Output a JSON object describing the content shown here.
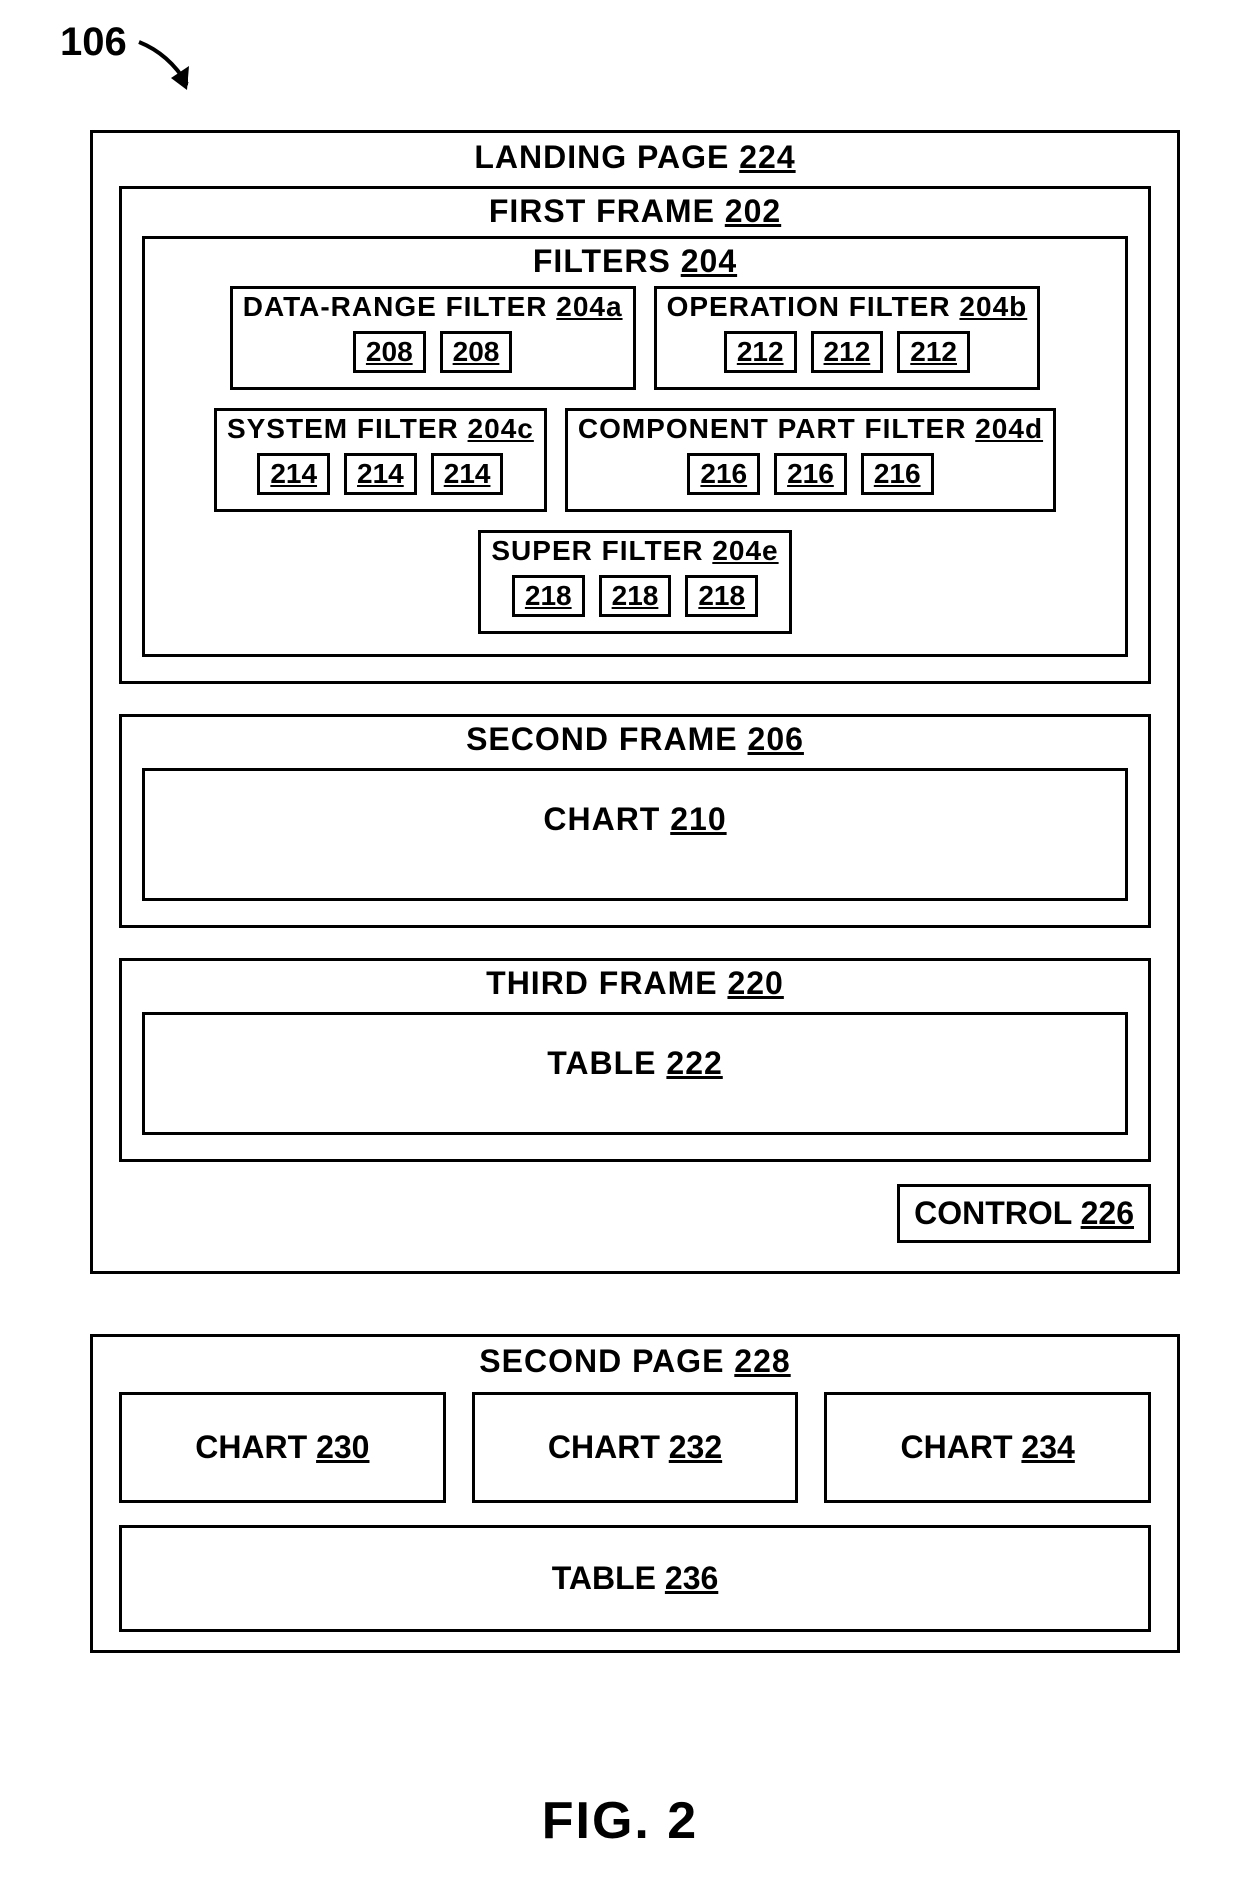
{
  "callout": {
    "ref": "106"
  },
  "landing_page": {
    "label": "LANDING PAGE",
    "ref": "224",
    "first_frame": {
      "label": "FIRST FRAME",
      "ref": "202",
      "filters": {
        "label": "FILTERS",
        "ref": "204",
        "items": [
          {
            "label": "DATA-RANGE FILTER",
            "ref": "204a",
            "tokens": [
              "208",
              "208"
            ]
          },
          {
            "label": "OPERATION FILTER",
            "ref": "204b",
            "tokens": [
              "212",
              "212",
              "212"
            ]
          },
          {
            "label": "SYSTEM FILTER",
            "ref": "204c",
            "tokens": [
              "214",
              "214",
              "214"
            ]
          },
          {
            "label": "COMPONENT PART FILTER",
            "ref": "204d",
            "tokens": [
              "216",
              "216",
              "216"
            ]
          },
          {
            "label": "SUPER FILTER",
            "ref": "204e",
            "tokens": [
              "218",
              "218",
              "218"
            ]
          }
        ]
      }
    },
    "second_frame": {
      "label": "SECOND FRAME",
      "ref": "206",
      "chart": {
        "label": "CHART",
        "ref": "210"
      }
    },
    "third_frame": {
      "label": "THIRD FRAME",
      "ref": "220",
      "table": {
        "label": "TABLE",
        "ref": "222"
      }
    },
    "control": {
      "label": "CONTROL",
      "ref": "226"
    }
  },
  "second_page": {
    "label": "SECOND PAGE",
    "ref": "228",
    "charts": [
      {
        "label": "CHART",
        "ref": "230"
      },
      {
        "label": "CHART",
        "ref": "232"
      },
      {
        "label": "CHART",
        "ref": "234"
      }
    ],
    "table": {
      "label": "TABLE",
      "ref": "236"
    }
  },
  "figure_caption": "FIG. 2"
}
